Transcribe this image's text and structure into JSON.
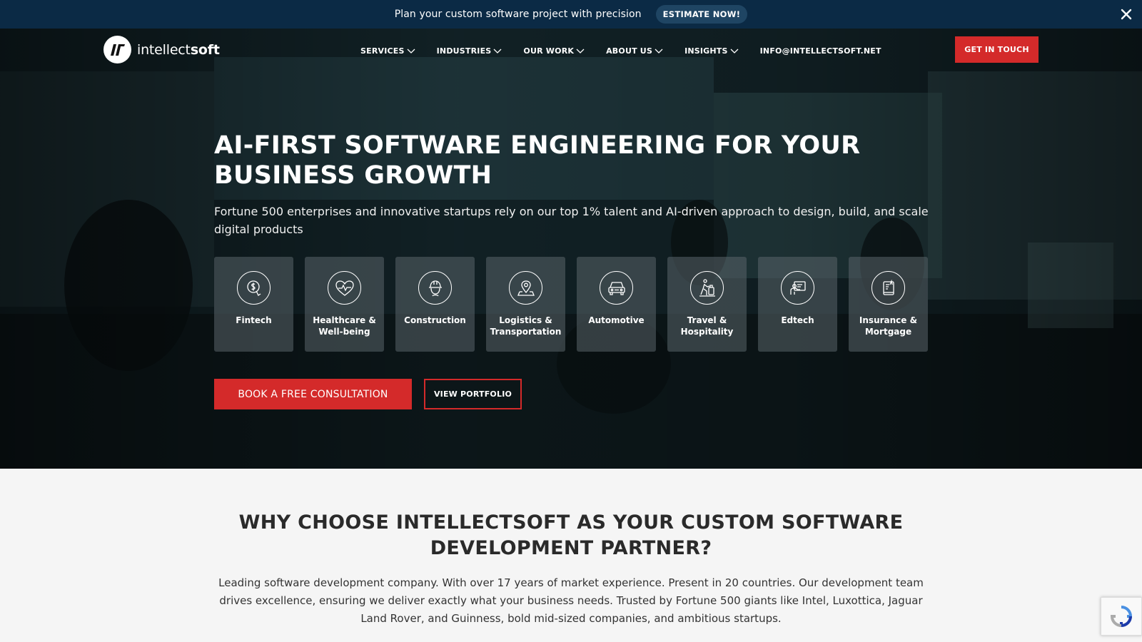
{
  "topbar": {
    "message": "Plan your custom software project with precision",
    "estimate_label": "ESTIMATE NOW!"
  },
  "logo": {
    "light": "intellect",
    "bold": "soft"
  },
  "nav": {
    "items": [
      {
        "label": "SERVICES",
        "dropdown": true
      },
      {
        "label": "INDUSTRIES",
        "dropdown": true
      },
      {
        "label": "OUR WORK",
        "dropdown": true
      },
      {
        "label": "ABOUT US",
        "dropdown": true
      },
      {
        "label": "INSIGHTS",
        "dropdown": true
      },
      {
        "label": "INFO@INTELLECTSOFT.NET",
        "dropdown": false
      }
    ],
    "cta_label": "GET IN TOUCH"
  },
  "hero": {
    "title": "AI-FIRST SOFTWARE ENGINEERING FOR YOUR BUSINESS GROWTH",
    "subtitle": "Fortune 500 enterprises and innovative startups rely on our top 1% talent and AI-driven approach to design, build, and scale digital products",
    "industries": [
      {
        "label": "Fintech",
        "icon": "fintech-icon"
      },
      {
        "label": "Healthcare & Well-being",
        "icon": "healthcare-icon"
      },
      {
        "label": "Construction",
        "icon": "construction-icon"
      },
      {
        "label": "Logistics & Transportation",
        "icon": "logistics-icon"
      },
      {
        "label": "Automotive",
        "icon": "automotive-icon"
      },
      {
        "label": "Travel & Hospitality",
        "icon": "travel-icon"
      },
      {
        "label": "Edtech",
        "icon": "edtech-icon"
      },
      {
        "label": "Insurance & Mortgage",
        "icon": "insurance-icon"
      }
    ],
    "book_label": "BOOK A FREE CONSULTATION",
    "portfolio_label": "VIEW PORTFOLIO"
  },
  "why": {
    "heading": "WHY CHOOSE INTELLECTSOFT AS YOUR CUSTOM SOFTWARE DEVELOPMENT PARTNER?",
    "body": "Leading software development company. With over 17 years of market experience. Present in 20 countries. Our development team drives excellence, ensuring we deliver exactly what your business needs. Trusted by Fortune 500 giants like Intel, Luxottica, Jaguar Land Rover, and Guinness, bold mid-sized companies, and ambitious startups."
  },
  "colors": {
    "topbar_bg": "#0b2a45",
    "accent_red": "#d42a2a",
    "section_bg": "#f5f5f5"
  }
}
